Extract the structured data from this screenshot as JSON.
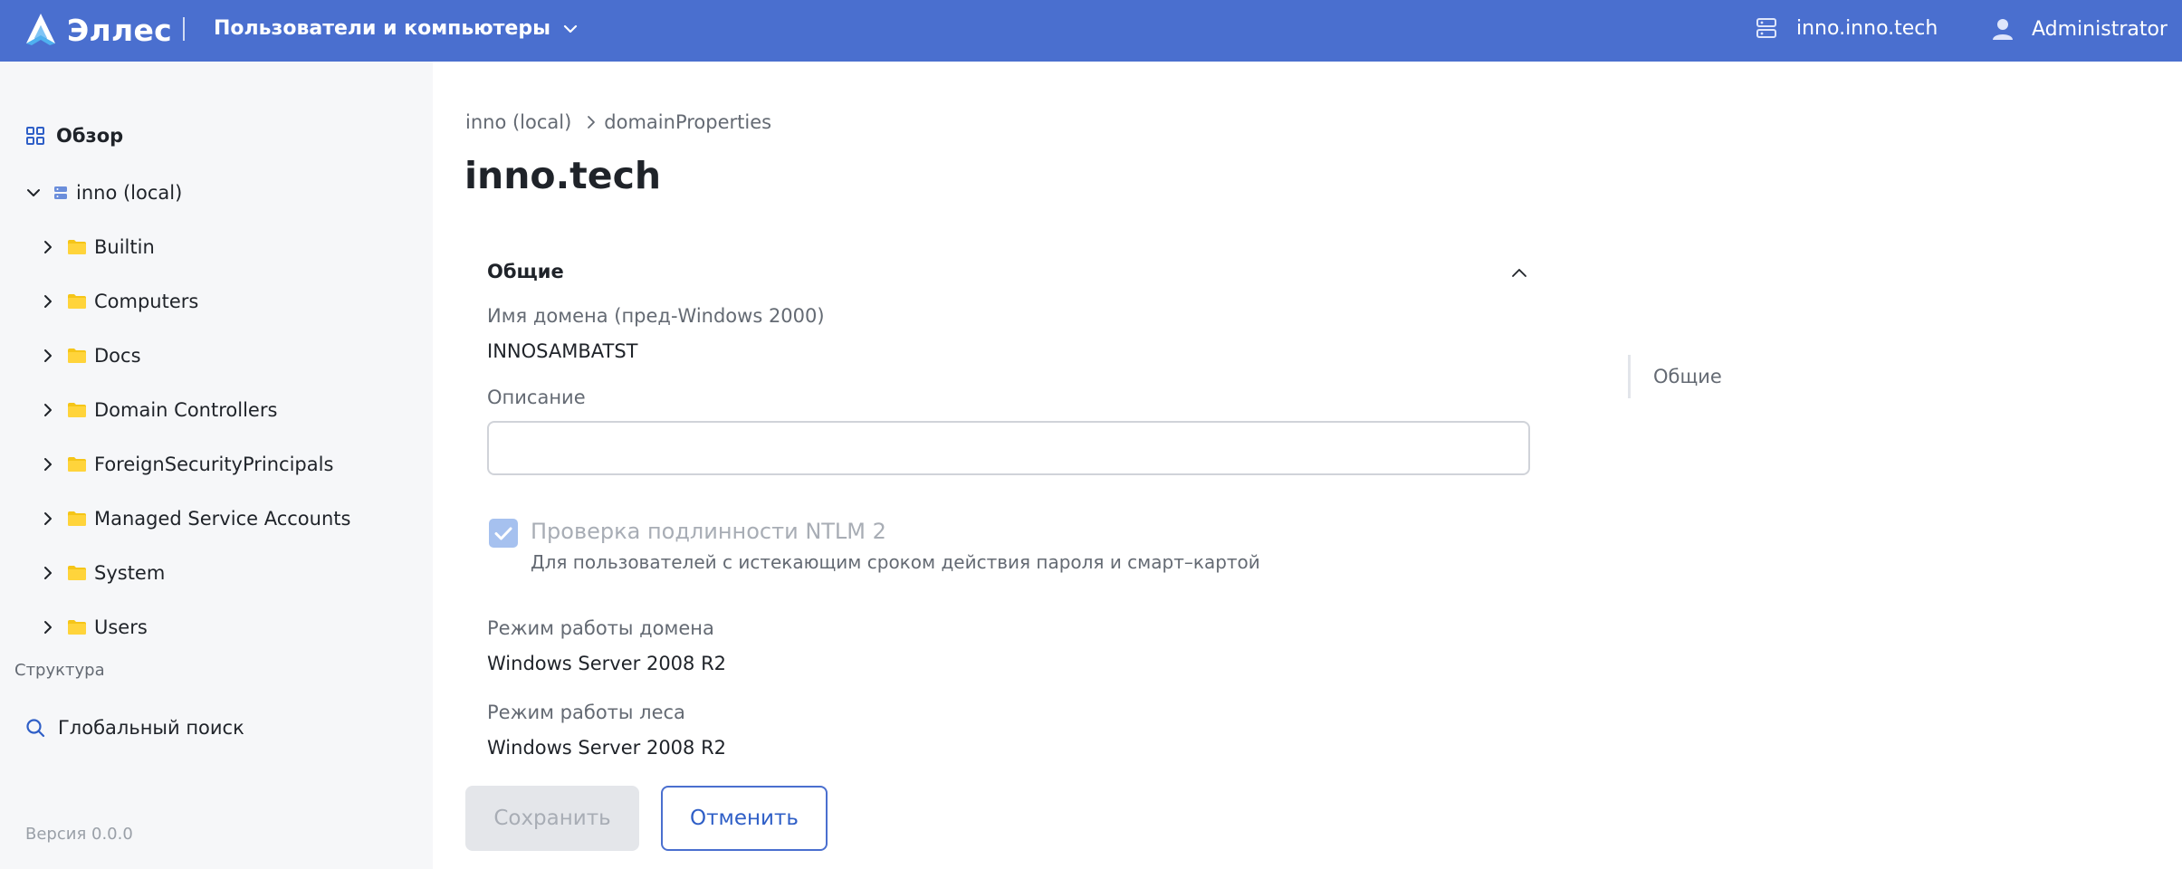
{
  "header": {
    "brand": "Эллес",
    "app_name": "Пользователи и компьютеры",
    "domain": "inno.inno.tech",
    "user": "Administrator",
    "color": "#4a6fcf"
  },
  "sidebar": {
    "overview": "Обзор",
    "root": "inno (local)",
    "children": [
      "Builtin",
      "Computers",
      "Docs",
      "Domain Controllers",
      "ForeignSecurityPrincipals",
      "Managed Service Accounts",
      "System",
      "Users"
    ],
    "section_label": "Структура",
    "search": "Глобальный поиск",
    "version": "Версия 0.0.0"
  },
  "main": {
    "breadcrumb": [
      "inno (local)",
      "domainProperties"
    ],
    "title": "inno.tech",
    "section_title": "Общие",
    "fields": {
      "netbios_label": "Имя домена (пред-Windows 2000)",
      "netbios_value": "INNOSAMBATST",
      "description_label": "Описание",
      "description_value": "",
      "ntlm_label": "Проверка подлинности NTLM 2",
      "ntlm_hint": "Для пользователей с истекающим сроком действия пароля и смарт–картой",
      "ntlm_checked": true,
      "domain_mode_label": "Режим работы домена",
      "domain_mode_value": "Windows Server 2008 R2",
      "forest_mode_label": "Режим работы леса",
      "forest_mode_value": "Windows Server 2008 R2"
    },
    "save_label": "Сохранить",
    "cancel_label": "Отменить"
  },
  "anchor": {
    "items": [
      "Общие"
    ]
  },
  "icons": {
    "logo": "elles-logo-icon",
    "app_switch": "chevron-down-icon",
    "domain": "server-icon",
    "user": "user-icon",
    "overview": "grid-icon",
    "tree_toggle": "chevron-icon",
    "folder": "folder-icon",
    "search": "search-icon",
    "checkbox": "check-icon"
  }
}
